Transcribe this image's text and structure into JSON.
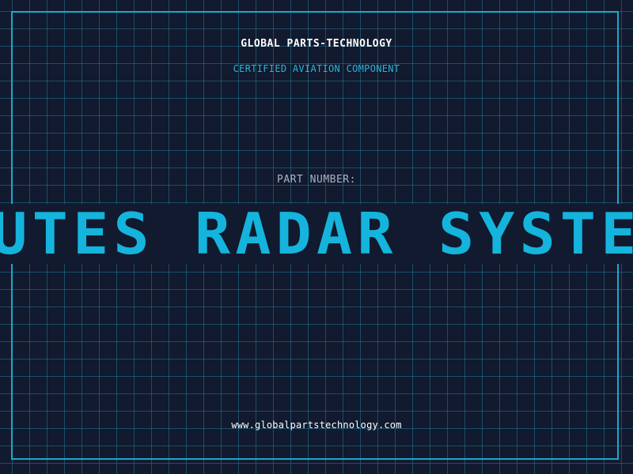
{
  "header": {
    "company": "GLOBAL PARTS-TECHNOLOGY",
    "tagline": "CERTIFIED AVIATION COMPONENT"
  },
  "part": {
    "label": "PART NUMBER:",
    "number": "MUTES RADAR SYSTEM"
  },
  "footer": {
    "website": "www.globalpartstechnology.com"
  },
  "colors": {
    "background": "#111a2e",
    "grid": "#227896",
    "accent": "#14b4dd",
    "text": "#ffffff",
    "label": "#a9b3c4"
  }
}
